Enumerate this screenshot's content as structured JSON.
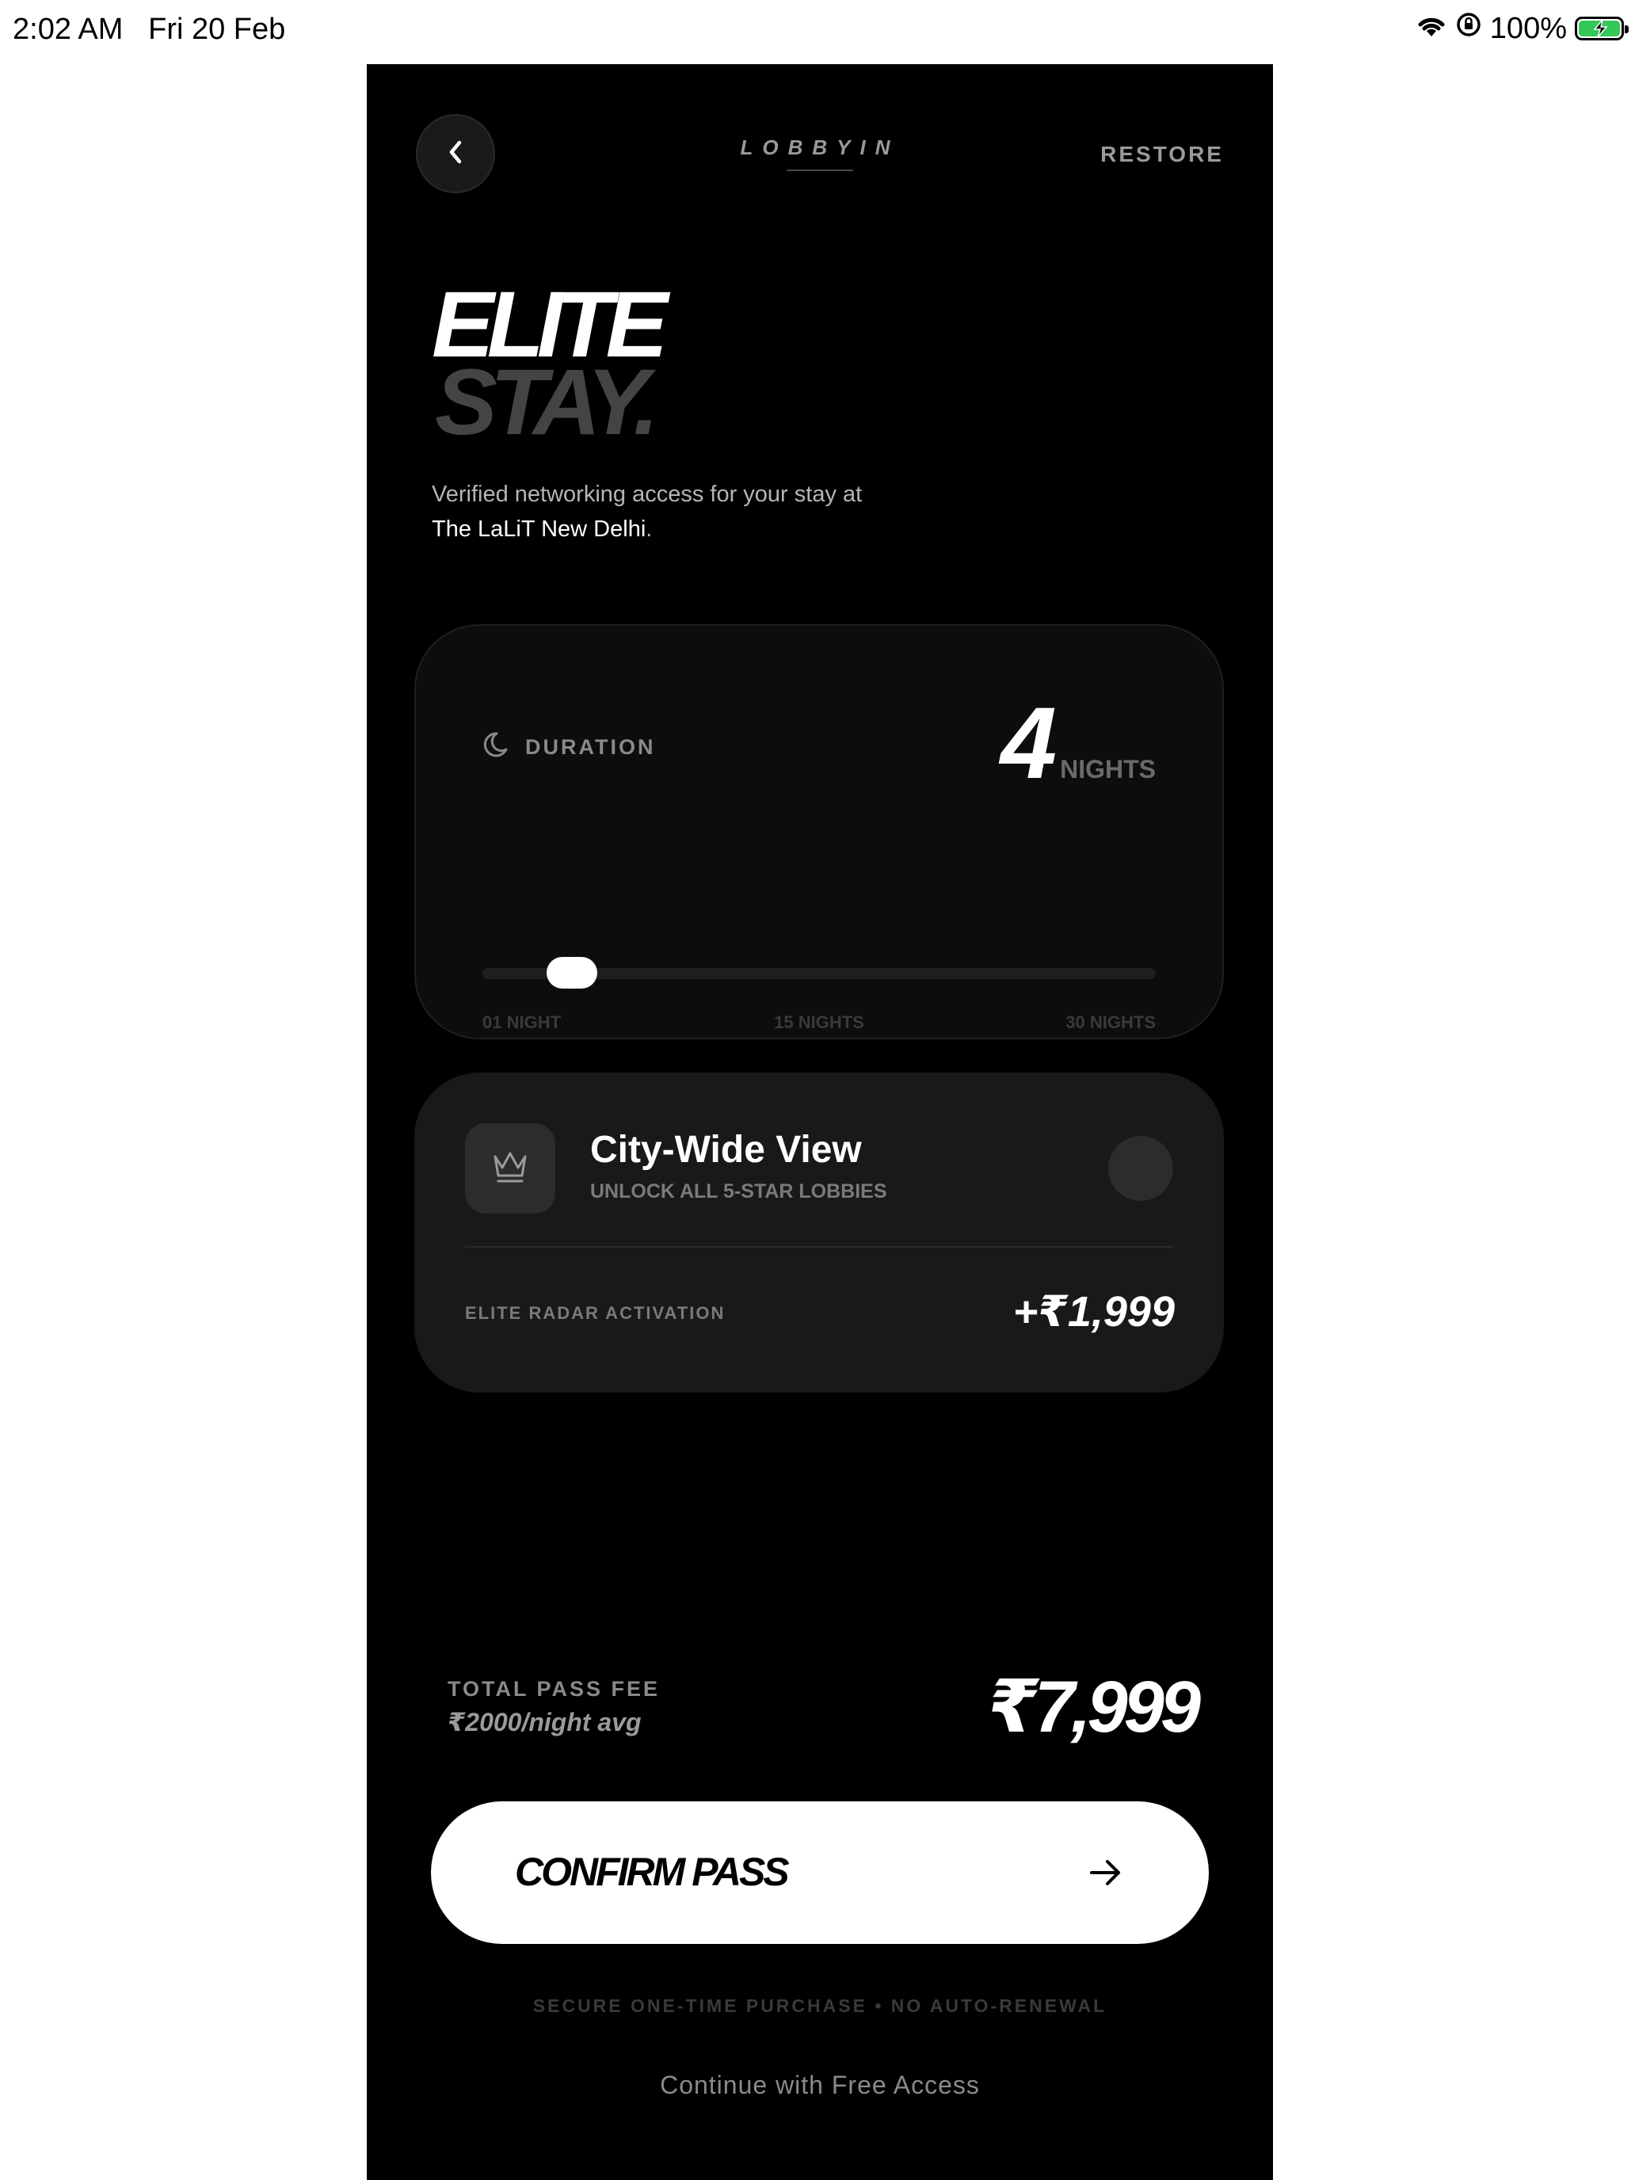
{
  "status_bar": {
    "time": "2:02 AM",
    "date": "Fri 20 Feb",
    "battery": "100%",
    "icons": [
      "wifi-icon",
      "orientation-lock-icon",
      "battery-charging-icon"
    ]
  },
  "header": {
    "brand": "LOBBYIN",
    "restore_label": "RESTORE",
    "back_icon": "chevron-left-icon"
  },
  "hero": {
    "line1": "ELITE",
    "line2": "STAY.",
    "subtitle_line1": "Verified networking access for your stay at",
    "venue": "The LaLiT New Delhi",
    "venue_suffix": "."
  },
  "duration": {
    "icon": "moon-icon",
    "label": "DURATION",
    "value": "4",
    "unit": "NIGHTS",
    "slider": {
      "min": 1,
      "max": 30,
      "value": 4
    },
    "ticks": {
      "min_label": "01 NIGHT",
      "mid_label": "15 NIGHTS",
      "max_label": "30 NIGHTS"
    }
  },
  "city_view": {
    "icon": "crown-icon",
    "title": "City-Wide View",
    "subtitle": "UNLOCK ALL 5-STAR LOBBIES",
    "selected": false,
    "radar_label": "ELITE RADAR ACTIVATION",
    "radar_price": "+₹1,999"
  },
  "total": {
    "label": "TOTAL PASS FEE",
    "avg": "₹2000/night avg",
    "price": "₹7,999"
  },
  "confirm": {
    "label": "CONFIRM PASS",
    "icon": "arrow-right-icon"
  },
  "secure_note": "SECURE ONE-TIME PURCHASE • NO AUTO-RENEWAL",
  "free_link": "Continue with Free Access",
  "colors": {
    "panel_bg": "#000000",
    "card_bg": "#0d0d0d",
    "city_card_bg": "#191919",
    "accent": "#ffffff",
    "muted": "#8a8a8a",
    "battery_fill": "#34c759"
  }
}
